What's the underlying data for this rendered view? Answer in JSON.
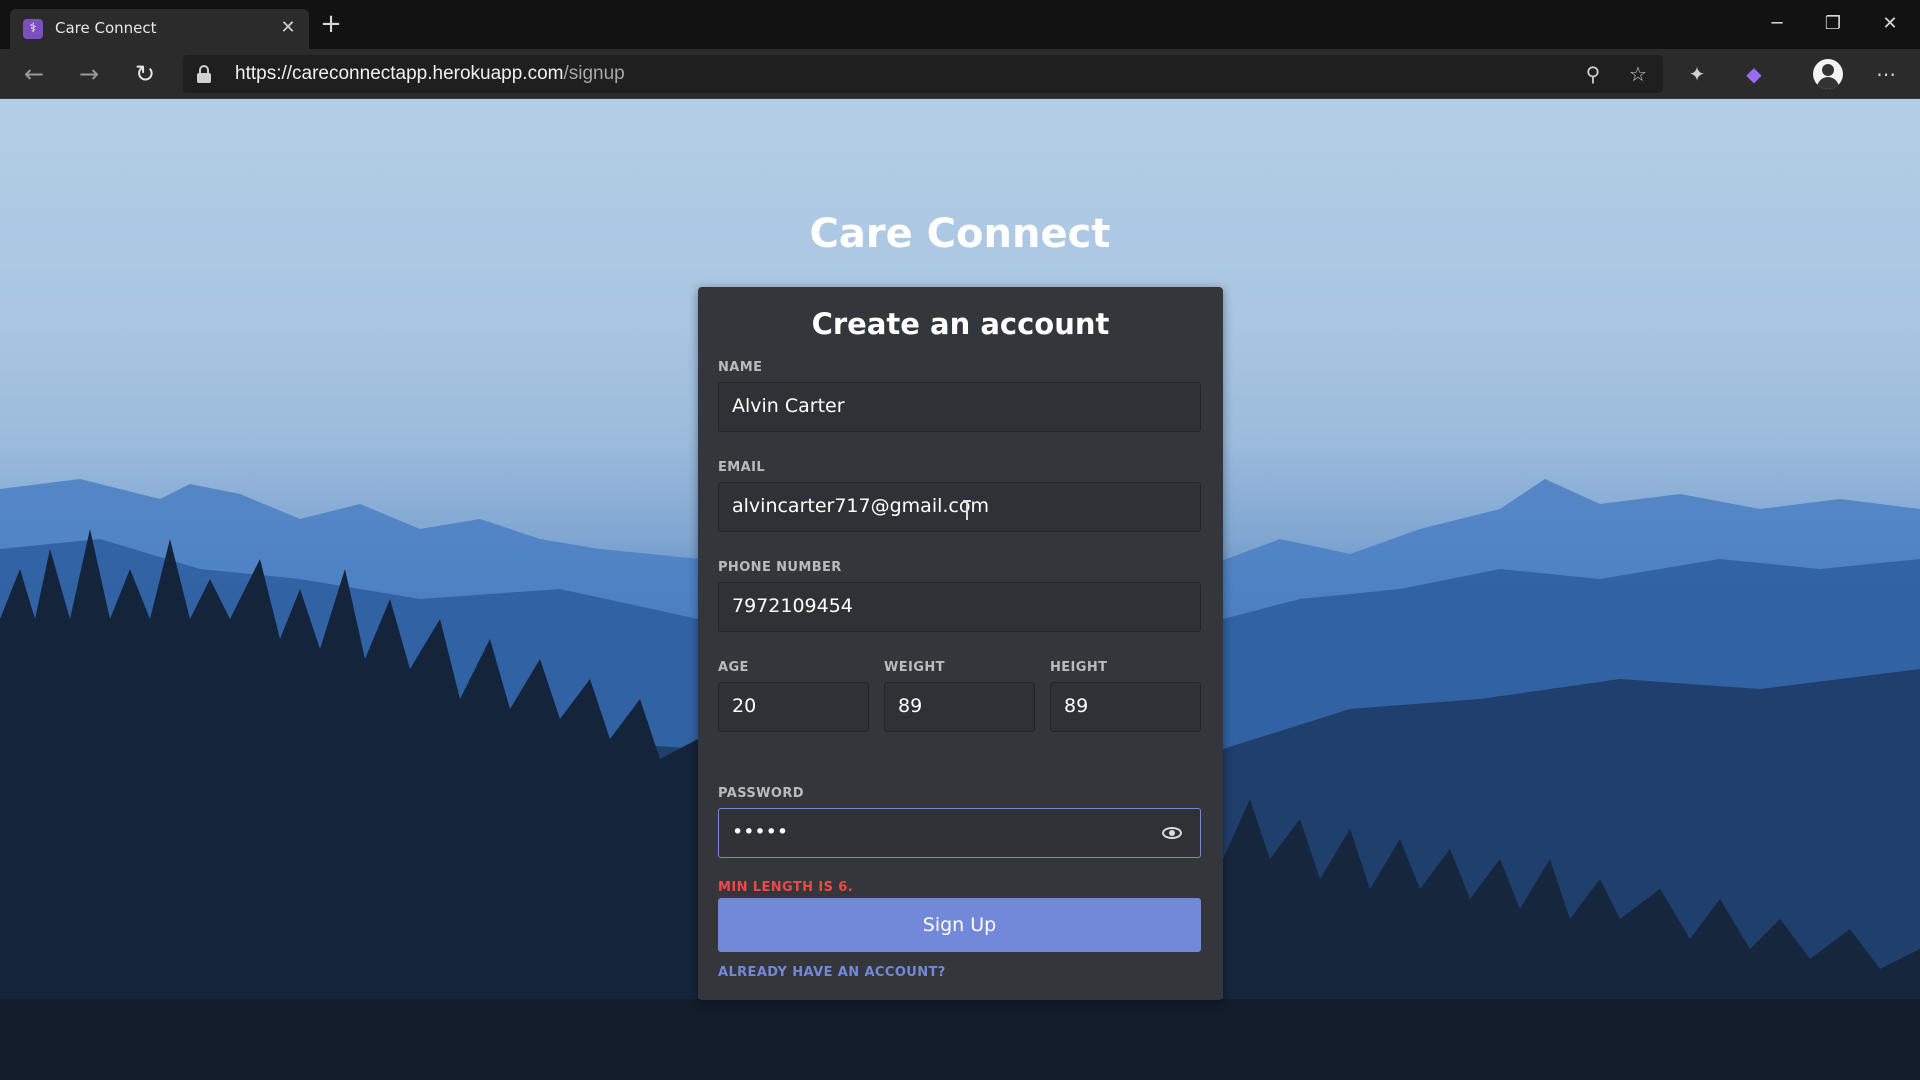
{
  "browser": {
    "tab_title": "Care Connect",
    "url_host": "https://careconnectapp.herokuapp.com",
    "url_path": "/signup"
  },
  "app": {
    "title": "Care Connect"
  },
  "form": {
    "heading": "Create an account",
    "name": {
      "label": "NAME",
      "value": "Alvin Carter"
    },
    "email": {
      "label": "EMAIL",
      "value": "alvincarter717@gmail.com"
    },
    "phone": {
      "label": "PHONE NUMBER",
      "value": "7972109454"
    },
    "age": {
      "label": "AGE",
      "value": "20"
    },
    "weight": {
      "label": "WEIGHT",
      "value": "89"
    },
    "height": {
      "label": "HEIGHT",
      "value": "89"
    },
    "password": {
      "label": "PASSWORD",
      "value": "•••••"
    },
    "error": "MIN LENGTH IS 6.",
    "submit_label": "Sign Up",
    "login_link": "ALREADY HAVE AN ACCOUNT?"
  },
  "icons": {
    "tab_favicon": "app-icon",
    "tab_close": "close-icon",
    "new_tab": "plus-icon",
    "back": "arrow-left-icon",
    "forward": "arrow-right-icon",
    "refresh": "refresh-icon",
    "lock": "lock-icon",
    "zoom": "zoom-icon",
    "favorite": "star-icon",
    "extension": "extension-icon",
    "profile": "avatar-icon",
    "menu": "more-icon",
    "password_toggle": "eye-icon"
  },
  "colors": {
    "accent": "#7289da",
    "error": "#f04747",
    "card": "#35363b",
    "input": "#2f3136"
  }
}
